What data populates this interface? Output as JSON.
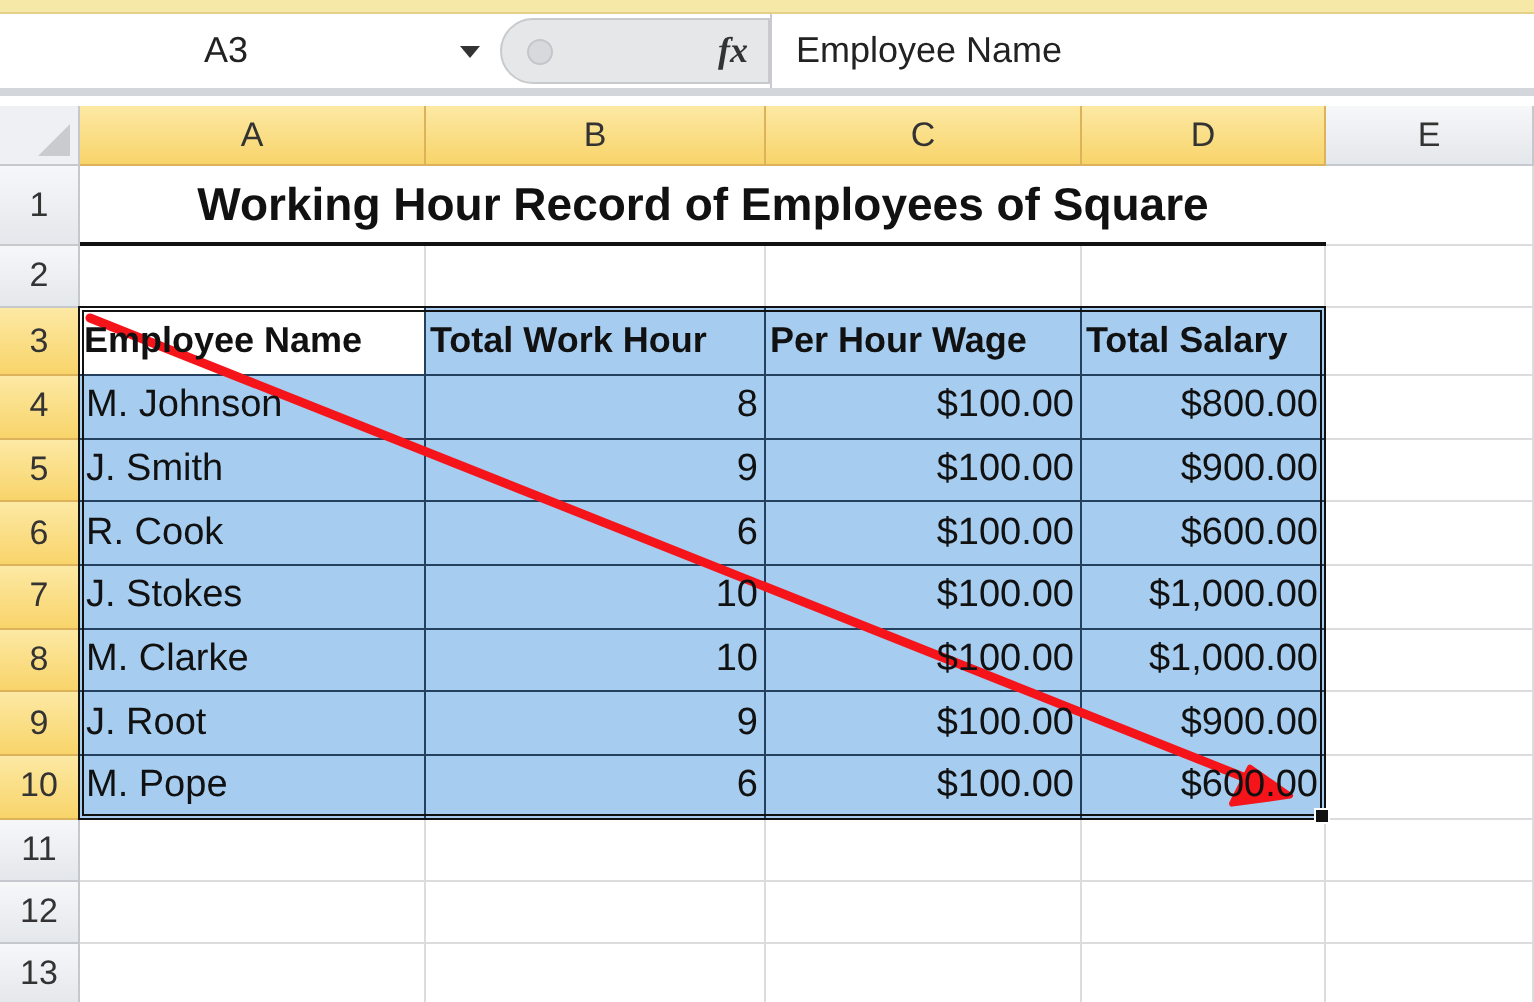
{
  "name_box": {
    "value": "A3"
  },
  "formula_bar": {
    "fx": "fx",
    "value": "Employee Name"
  },
  "columns": [
    {
      "label": "A",
      "selected": true
    },
    {
      "label": "B",
      "selected": true
    },
    {
      "label": "C",
      "selected": true
    },
    {
      "label": "D",
      "selected": true
    },
    {
      "label": "E",
      "selected": false
    }
  ],
  "rows": [
    {
      "label": "1",
      "selected": false,
      "kind": "title",
      "title": "Working Hour Record of Employees of Square"
    },
    {
      "label": "2",
      "selected": false,
      "kind": "blank"
    },
    {
      "label": "3",
      "selected": true,
      "kind": "header",
      "cells": [
        {
          "text": "Employee Name",
          "selected": true,
          "active": true
        },
        {
          "text": "Total Work Hour",
          "selected": true,
          "active": false
        },
        {
          "text": "Per Hour Wage",
          "selected": true,
          "active": false
        },
        {
          "text": "Total Salary",
          "selected": true,
          "active": false
        }
      ]
    },
    {
      "label": "4",
      "selected": true,
      "kind": "data",
      "cells": [
        {
          "text": "M. Johnson",
          "selected": true,
          "active": false
        },
        {
          "text": "8",
          "selected": true,
          "active": false
        },
        {
          "text": "$100.00",
          "selected": true,
          "active": false
        },
        {
          "text": "$800.00",
          "selected": true,
          "active": false
        }
      ]
    },
    {
      "label": "5",
      "selected": true,
      "kind": "data",
      "cells": [
        {
          "text": "J. Smith",
          "selected": true,
          "active": false
        },
        {
          "text": "9",
          "selected": true,
          "active": false
        },
        {
          "text": "$100.00",
          "selected": true,
          "active": false
        },
        {
          "text": "$900.00",
          "selected": true,
          "active": false
        }
      ]
    },
    {
      "label": "6",
      "selected": true,
      "kind": "data",
      "cells": [
        {
          "text": "R. Cook",
          "selected": true,
          "active": false
        },
        {
          "text": "6",
          "selected": true,
          "active": false
        },
        {
          "text": "$100.00",
          "selected": true,
          "active": false
        },
        {
          "text": "$600.00",
          "selected": true,
          "active": false
        }
      ]
    },
    {
      "label": "7",
      "selected": true,
      "kind": "data",
      "cells": [
        {
          "text": "J. Stokes",
          "selected": true,
          "active": false
        },
        {
          "text": "10",
          "selected": true,
          "active": false
        },
        {
          "text": "$100.00",
          "selected": true,
          "active": false
        },
        {
          "text": "$1,000.00",
          "selected": true,
          "active": false
        }
      ]
    },
    {
      "label": "8",
      "selected": true,
      "kind": "data",
      "cells": [
        {
          "text": "M. Clarke",
          "selected": true,
          "active": false
        },
        {
          "text": "10",
          "selected": true,
          "active": false
        },
        {
          "text": "$100.00",
          "selected": true,
          "active": false
        },
        {
          "text": "$1,000.00",
          "selected": true,
          "active": false
        }
      ]
    },
    {
      "label": "9",
      "selected": true,
      "kind": "data",
      "cells": [
        {
          "text": "J. Root",
          "selected": true,
          "active": false
        },
        {
          "text": "9",
          "selected": true,
          "active": false
        },
        {
          "text": "$100.00",
          "selected": true,
          "active": false
        },
        {
          "text": "$900.00",
          "selected": true,
          "active": false
        }
      ]
    },
    {
      "label": "10",
      "selected": true,
      "kind": "data",
      "cells": [
        {
          "text": "M. Pope",
          "selected": true,
          "active": false
        },
        {
          "text": "6",
          "selected": true,
          "active": false
        },
        {
          "text": "$100.00",
          "selected": true,
          "active": false
        },
        {
          "text": "$600.00",
          "selected": true,
          "active": false
        }
      ]
    },
    {
      "label": "11",
      "selected": false,
      "kind": "blank"
    },
    {
      "label": "12",
      "selected": false,
      "kind": "blank"
    },
    {
      "label": "13",
      "selected": false,
      "kind": "blank"
    }
  ]
}
